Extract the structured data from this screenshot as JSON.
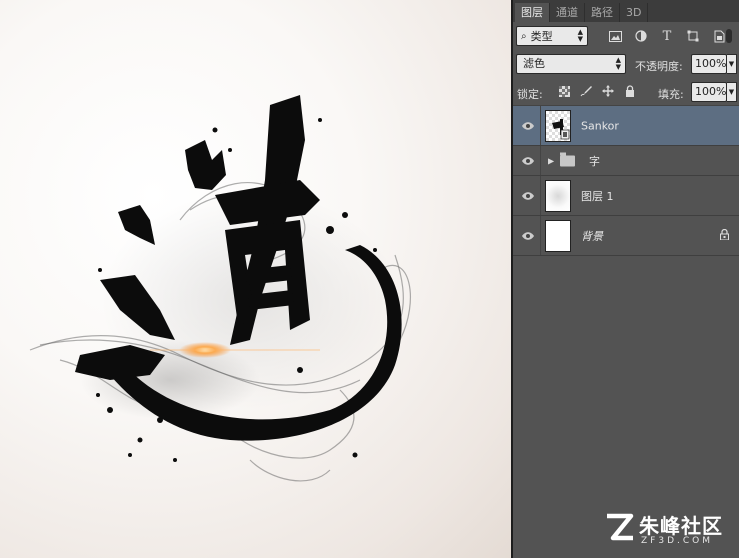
{
  "tabs": [
    {
      "label": "图层",
      "active": true
    },
    {
      "label": "通道",
      "active": false
    },
    {
      "label": "路径",
      "active": false
    },
    {
      "label": "3D",
      "active": false
    }
  ],
  "filter": {
    "kind_label": "类型",
    "icons": [
      "image-filter-icon",
      "adjustment-filter-icon",
      "type-filter-icon",
      "shape-filter-icon",
      "smart-object-filter-icon"
    ]
  },
  "blend": {
    "mode": "滤色",
    "opacity_label": "不透明度:",
    "opacity_value": "100%"
  },
  "lock": {
    "label": "锁定:",
    "fill_label": "填充:",
    "fill_value": "100%"
  },
  "layers": [
    {
      "name": "Sankor",
      "type": "smart-object",
      "selected": true
    },
    {
      "name": "字",
      "type": "group",
      "selected": false
    },
    {
      "name": "图层 1",
      "type": "pixel",
      "selected": false
    },
    {
      "name": "背景",
      "type": "background",
      "selected": false,
      "locked": true
    }
  ],
  "watermark": {
    "main": "朱峰社区",
    "sub": "ZF3D.COM"
  },
  "colors": {
    "panel_bg": "#535353",
    "selected_layer": "#5d6e82",
    "tab_bar": "#3c3c3c"
  }
}
